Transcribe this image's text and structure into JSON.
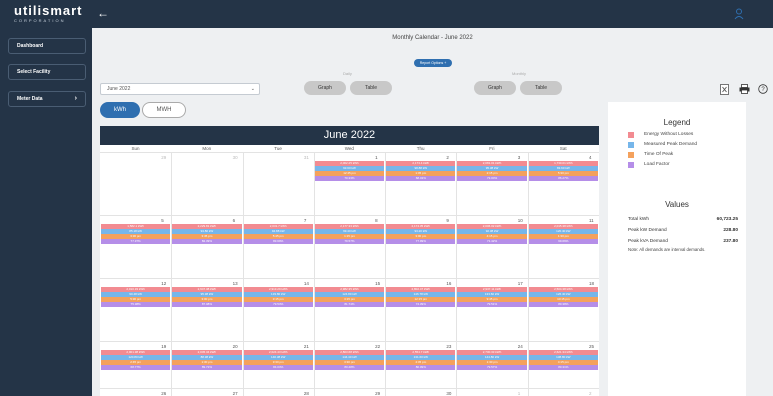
{
  "app": {
    "logo": "utilismart",
    "logo_sub": "CORPORATION"
  },
  "sidebar": {
    "items": [
      {
        "label": "Dashboard"
      },
      {
        "label": "Select Facility"
      },
      {
        "label": "Meter Data",
        "chevron": "›"
      }
    ]
  },
  "page": {
    "title": "Monthly Calendar - June 2022",
    "report_options": "Report Options +"
  },
  "controls": {
    "month_select": "June 2022",
    "daily_label": "Daily",
    "monthly_label": "Monthly",
    "daily_graph": "Graph",
    "daily_table": "Table",
    "monthly_graph": "Graph",
    "monthly_table": "Table",
    "unit_kwh": "kWh",
    "unit_mwh": "MWH"
  },
  "calendar": {
    "header": "June 2022",
    "days_of_week": [
      "Sun",
      "Mon",
      "Tue",
      "Wed",
      "Thu",
      "Fri",
      "Sat"
    ],
    "weeks": [
      {
        "days": [
          {
            "num": "29",
            "other": true
          },
          {
            "num": "30",
            "other": true
          },
          {
            "num": "31",
            "other": true
          },
          {
            "num": "1",
            "energy": "2,002.25 kWh",
            "peak": "93.60 kW",
            "time": "12:45 pm",
            "lf": "70.33%"
          },
          {
            "num": "2",
            "energy": "2,173.4 kWh",
            "peak": "98.88 kW",
            "time": "1:45 pm",
            "lf": "68.43%"
          },
          {
            "num": "3",
            "energy": "2,081.01 kWh",
            "peak": "95.38 kW",
            "time": "2:15 pm",
            "lf": "73.00%"
          },
          {
            "num": "4",
            "energy": "1,730.01 kWh",
            "peak": "83.60 kW",
            "time": "5:30 pm",
            "lf": "86.27%"
          }
        ]
      },
      {
        "days": [
          {
            "num": "5",
            "energy": "1,582.1 kWh",
            "peak": "85.18 kW",
            "time": "3:30 pm",
            "lf": "77.37%"
          },
          {
            "num": "6",
            "energy": "2,229.81 kWh",
            "peak": "94.80 kW",
            "time": "3:45 pm",
            "lf": "82.39%"
          },
          {
            "num": "7",
            "energy": "2,031.7 kWh",
            "peak": "94.88 kW",
            "time": "5:45 pm",
            "lf": "83.69%"
          },
          {
            "num": "8",
            "energy": "2,177.33 kWh",
            "peak": "99.40 kW",
            "time": "1:15 pm",
            "lf": "79.57%"
          },
          {
            "num": "9",
            "energy": "2,174.35 kWh",
            "peak": "93.20 kW",
            "time": "3:00 pm",
            "lf": "77.99%"
          },
          {
            "num": "10",
            "energy": "2,006.02 kWh",
            "peak": "92.38 kW",
            "time": "4:15 pm",
            "lf": "71.42%"
          },
          {
            "num": "11",
            "energy": "2,015.38 kWh",
            "peak": "120.40 kW",
            "time": "1:30 pm",
            "lf": "69.66%"
          }
        ]
      },
      {
        "days": [
          {
            "num": "12",
            "energy": "2,010.33 kWh",
            "peak": "90.48 kW",
            "time": "5:30 pm",
            "lf": "75.38%"
          },
          {
            "num": "13",
            "energy": "2,947.38 kWh",
            "peak": "95.38 kW",
            "time": "3:00 pm",
            "lf": "87.08%"
          },
          {
            "num": "14",
            "energy": "2,913.29 kWh",
            "peak": "133.80 kW",
            "time": "3:15 pm",
            "lf": "79.53%"
          },
          {
            "num": "15",
            "energy": "2,982.35 kWh",
            "peak": "124.80 kW",
            "time": "3:15 pm",
            "lf": "81.74%"
          },
          {
            "num": "16",
            "energy": "2,802.47 kWh",
            "peak": "146.78 kW",
            "time": "12:15 pm",
            "lf": "74.39%"
          },
          {
            "num": "17",
            "energy": "2,937.11 kWh",
            "peak": "133.60 kW",
            "time": "9:45 pm",
            "lf": "79.51%"
          },
          {
            "num": "18",
            "energy": "2,504.38 kWh",
            "peak": "126.40 kW",
            "time": "10:15 pm",
            "lf": "80.38%"
          }
        ]
      },
      {
        "days": [
          {
            "num": "19",
            "energy": "2,001.38 kWh",
            "peak": "120.80 kW",
            "time": "2:45 pm",
            "lf": "68.77%"
          },
          {
            "num": "20",
            "energy": "2,045.34 kWh",
            "peak": "88.38 kW",
            "time": "1:30 pm",
            "lf": "89.72%"
          },
          {
            "num": "21",
            "energy": "2,024.43 kWh",
            "peak": "140.38 kW",
            "time": "3:30 pm",
            "lf": "84.03%"
          },
          {
            "num": "22",
            "energy": "2,803.68 kWh",
            "peak": "144.40 kW",
            "time": "3:30 pm",
            "lf": "80.48%"
          },
          {
            "num": "23",
            "energy": "2,554.7 kWh",
            "peak": "131.60 kW",
            "time": "4:45 pm",
            "lf": "80.09%"
          },
          {
            "num": "24",
            "energy": "2,700.33 kWh",
            "peak": "144.80 kW",
            "time": "1:30 pm",
            "lf": "79.57%"
          },
          {
            "num": "25",
            "energy": "2,621.34 kWh",
            "peak": "138.80 kW",
            "time": "4:15 pm",
            "lf": "80.31%"
          }
        ]
      },
      {
        "days": [
          {
            "num": "26"
          },
          {
            "num": "27"
          },
          {
            "num": "28"
          },
          {
            "num": "29"
          },
          {
            "num": "30"
          },
          {
            "num": "1",
            "other": true
          },
          {
            "num": "2",
            "other": true
          }
        ]
      }
    ]
  },
  "legend": {
    "title": "Legend",
    "items": [
      {
        "label": "Energy Without Losses",
        "color": "#f28b91"
      },
      {
        "label": "Measured Peak Demand",
        "color": "#76b6ea"
      },
      {
        "label": "Time Of Peak",
        "color": "#f4a15d"
      },
      {
        "label": "Load Factor",
        "color": "#b58ee8"
      }
    ]
  },
  "values": {
    "title": "Values",
    "rows": [
      {
        "label": "Total kWh",
        "value": "60,723.25"
      },
      {
        "label": "Peak kW Demand",
        "value": "228.80"
      },
      {
        "label": "Peak kVA Demand",
        "value": "237.80"
      }
    ],
    "note": "Note: All demands are interval demands."
  }
}
